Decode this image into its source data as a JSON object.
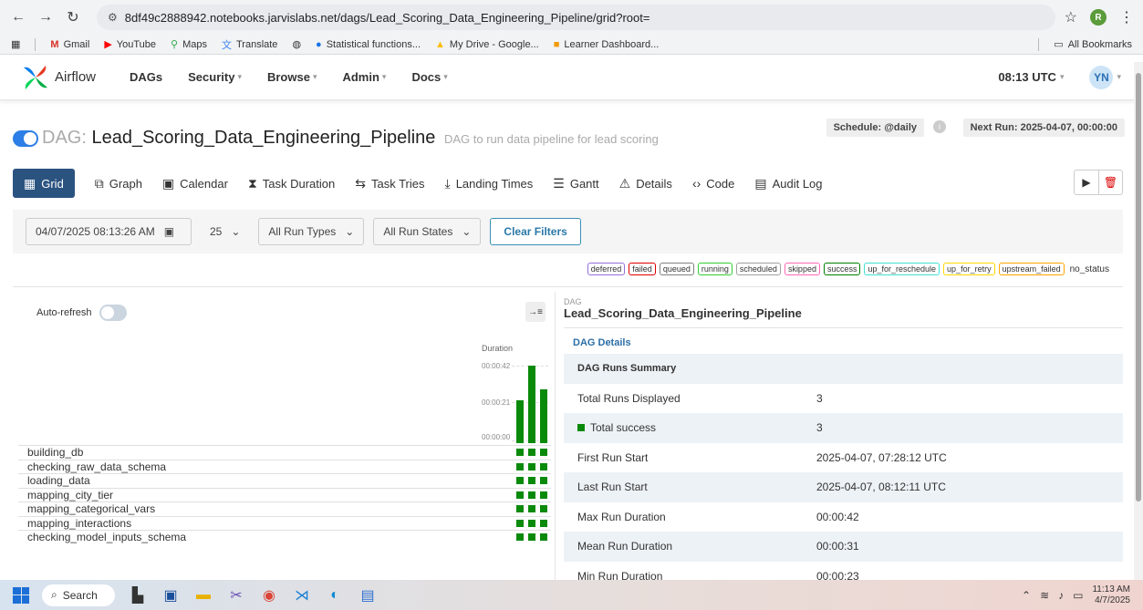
{
  "browser": {
    "url": "8df49c2888942.notebooks.jarvislabs.net/dags/Lead_Scoring_Data_Engineering_Pipeline/grid?root=",
    "profile_initial": "R",
    "bookmarks": [
      "Gmail",
      "YouTube",
      "Maps",
      "Translate",
      "Statistical functions...",
      "My Drive - Google...",
      "Learner Dashboard..."
    ],
    "all_bookmarks": "All Bookmarks"
  },
  "navbar": {
    "brand": "Airflow",
    "menu": [
      "DAGs",
      "Security",
      "Browse",
      "Admin",
      "Docs"
    ],
    "time": "08:13 UTC",
    "user_initials": "YN"
  },
  "dag": {
    "prefix": "DAG:",
    "name": "Lead_Scoring_Data_Engineering_Pipeline",
    "description": "DAG to run data pipeline for lead scoring",
    "schedule": "Schedule: @daily",
    "next_run": "Next Run: 2025-04-07, 00:00:00"
  },
  "tabs": [
    "Grid",
    "Graph",
    "Calendar",
    "Task Duration",
    "Task Tries",
    "Landing Times",
    "Gantt",
    "Details",
    "Code",
    "Audit Log"
  ],
  "filters": {
    "datetime": "04/07/2025 08:13:26 AM",
    "num_runs": "25",
    "run_types": "All Run Types",
    "run_states": "All Run States",
    "clear": "Clear Filters"
  },
  "legend": [
    {
      "label": "deferred",
      "color": "#9370db"
    },
    {
      "label": "failed",
      "color": "#e00000"
    },
    {
      "label": "queued",
      "color": "#808080"
    },
    {
      "label": "running",
      "color": "#32cd32"
    },
    {
      "label": "scheduled",
      "color": "#a0a0a0"
    },
    {
      "label": "skipped",
      "color": "#ff69b4"
    },
    {
      "label": "success",
      "color": "#008000"
    },
    {
      "label": "up_for_reschedule",
      "color": "#40e0d0"
    },
    {
      "label": "up_for_retry",
      "color": "#ffd700"
    },
    {
      "label": "upstream_failed",
      "color": "#ffa500"
    }
  ],
  "legend_plain": "no_status",
  "grid": {
    "auto_refresh": "Auto-refresh",
    "duration_label": "Duration",
    "ticks": [
      "00:00:42",
      "00:00:21",
      "00:00:00"
    ],
    "run_durations_sec": [
      23,
      42,
      29
    ],
    "duration_max_sec": 42,
    "tasks": [
      "building_db",
      "checking_raw_data_schema",
      "loading_data",
      "mapping_city_tier",
      "mapping_categorical_vars",
      "mapping_interactions",
      "checking_model_inputs_schema"
    ]
  },
  "details": {
    "label": "DAG",
    "title": "Lead_Scoring_Data_Engineering_Pipeline",
    "link": "DAG Details",
    "summary_header": "DAG Runs Summary",
    "rows": [
      {
        "k": "Total Runs Displayed",
        "v": "3"
      },
      {
        "k": "Total success",
        "v": "3"
      },
      {
        "k": "First Run Start",
        "v": "2025-04-07, 07:28:12 UTC"
      },
      {
        "k": "Last Run Start",
        "v": "2025-04-07, 08:12:11 UTC"
      },
      {
        "k": "Max Run Duration",
        "v": "00:00:42"
      },
      {
        "k": "Mean Run Duration",
        "v": "00:00:31"
      },
      {
        "k": "Min Run Duration",
        "v": "00:00:23"
      }
    ]
  },
  "taskbar": {
    "search": "Search",
    "time": "11:13 AM",
    "date": "4/7/2025"
  }
}
